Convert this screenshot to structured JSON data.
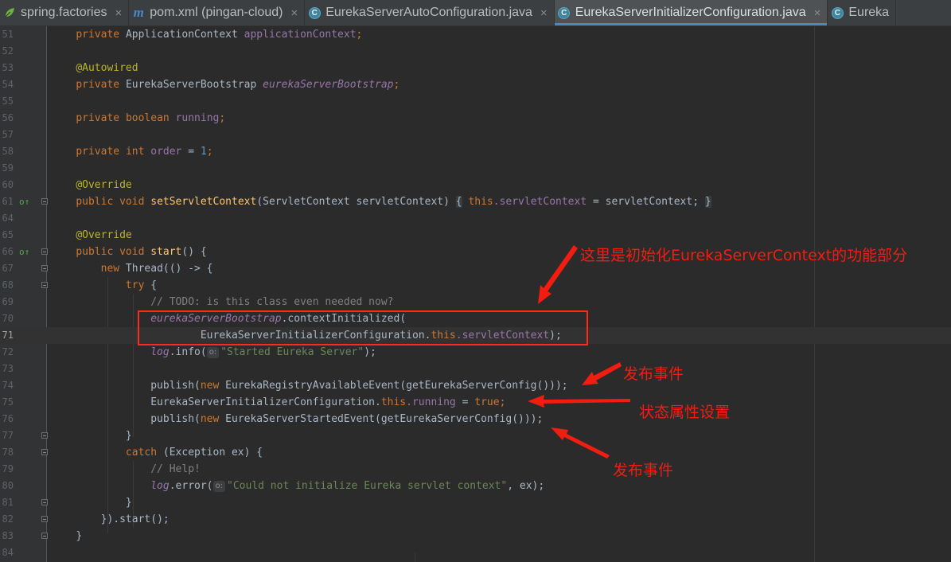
{
  "tabs": [
    {
      "label": "spring.factories",
      "icon": "spring-leaf-icon",
      "active": false
    },
    {
      "label": "pom.xml (pingan-cloud)",
      "icon": "maven-icon",
      "active": false
    },
    {
      "label": "EurekaServerAutoConfiguration.java",
      "icon": "java-class-icon",
      "active": false
    },
    {
      "label": "EurekaServerInitializerConfiguration.java",
      "icon": "java-class-icon",
      "active": true
    },
    {
      "label": "Eureka",
      "icon": "java-class-icon",
      "active": false
    }
  ],
  "tab_close_glyph": "×",
  "gutter": {
    "line_numbers": [
      "51",
      "52",
      "53",
      "54",
      "55",
      "56",
      "57",
      "58",
      "59",
      "60",
      "61",
      "64",
      "65",
      "66",
      "67",
      "68",
      "69",
      "70",
      "71",
      "72",
      "73",
      "74",
      "75",
      "76",
      "77",
      "78",
      "79",
      "80",
      "81",
      "82",
      "83",
      "84"
    ],
    "override_marker": "o↑",
    "current_line": "71"
  },
  "code": {
    "l51": {
      "kw": "private",
      "type": "ApplicationContext",
      "field": "applicationContext",
      "semi": ";"
    },
    "l53": {
      "ann": "@Autowired"
    },
    "l54": {
      "kw": "private",
      "type": "EurekaServerBootstrap",
      "field": "eurekaServerBootstrap",
      "semi": ";"
    },
    "l56": {
      "kw": "private",
      "kw2": "boolean",
      "field": "running",
      "semi": ";"
    },
    "l58": {
      "kw": "private",
      "kw2": "int",
      "field": "order",
      "eq": " = ",
      "num": "1",
      "semi": ";"
    },
    "l60": {
      "ann": "@Override"
    },
    "l61": {
      "kw1": "public",
      "kw2": "void",
      "method": "setServletContext",
      "params": "(ServletContext servletContext)",
      "open": "{",
      "this": "this",
      "field": ".servletContext",
      "rest": " = servletContext;",
      "close": "}"
    },
    "l65": {
      "ann": "@Override"
    },
    "l66": {
      "kw1": "public",
      "kw2": "void",
      "method": "start",
      "rest": "() {"
    },
    "l67": {
      "kw": "new",
      "rest": " Thread(() -> {"
    },
    "l68": {
      "kw": "try",
      "rest": " {"
    },
    "l69": {
      "comment": "// TODO: is this class even needed now?"
    },
    "l70": {
      "field": "eurekaServerBootstrap",
      "rest": ".contextInitialized("
    },
    "l71": {
      "cls": "EurekaServerInitializerConfiguration.",
      "this": "this",
      "field": ".servletContext",
      "rest": ");"
    },
    "l72": {
      "log": "log",
      "rest": ".info(",
      "hint": "o:",
      "str": "\"Started Eureka Server\"",
      "end": ");"
    },
    "l74": {
      "pre": "publish(",
      "kw": "new",
      "rest": " EurekaRegistryAvailableEvent(getEurekaServerConfig()));"
    },
    "l75": {
      "cls": "EurekaServerInitializerConfiguration.",
      "this": "this",
      "field": ".running",
      "eq": " = ",
      "kw": "true",
      "semi": ";"
    },
    "l76": {
      "pre": "publish(",
      "kw": "new",
      "rest": " EurekaServerStartedEvent(getEurekaServerConfig()));"
    },
    "l77": {
      "rest": "}"
    },
    "l78": {
      "kw": "catch",
      "rest": " (Exception ex) {"
    },
    "l79": {
      "comment": "// Help!"
    },
    "l80": {
      "log": "log",
      "rest": ".error(",
      "hint": "o:",
      "str": "\"Could not initialize Eureka servlet context\"",
      "end": ", ex);"
    },
    "l81": {
      "rest": "}"
    },
    "l82": {
      "rest": "}).start();"
    },
    "l83": {
      "rest": "}"
    }
  },
  "annotations": {
    "init_note": "这里是初始化EurekaServerContext的功能部分",
    "publish_note_1": "发布事件",
    "state_note": "状态属性设置",
    "publish_note_2": "发布事件"
  },
  "colors": {
    "background": "#2b2b2b",
    "keyword": "#cc7832",
    "field": "#9876aa",
    "annotation": "#bbb529",
    "method": "#ffc66d",
    "string": "#6a8759",
    "comment": "#808080",
    "markup_red": "#f21d10"
  }
}
